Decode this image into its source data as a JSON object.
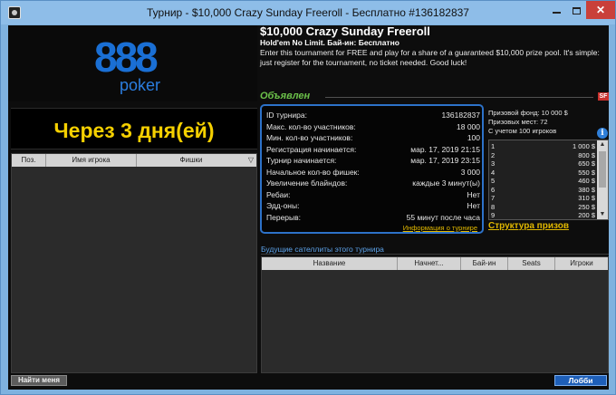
{
  "window": {
    "title": "Турнир - $10,000 Crazy Sunday Freeroll - Бесплатно #136182837",
    "controls": {
      "minimize_icon": "minimize-icon",
      "maximize_icon": "maximize-icon",
      "close_label": "✕"
    }
  },
  "logo": {
    "top": "888",
    "bottom": "poker"
  },
  "countdown": "Через 3 дня(ей)",
  "players_table": {
    "columns": [
      "Поз.",
      "Имя игрока",
      "Фишки"
    ],
    "sort_icon": "▽",
    "rows": []
  },
  "find_me_button": "Найти меня",
  "tournament": {
    "name": "$10,000 Crazy Sunday Freeroll",
    "game_line": "Hold'em No Limit. Бай-ин: Бесплатно",
    "description": "Enter this tournament for FREE and play for a share of a guaranteed $10,000 prize pool.  It's simple: just register for the tournament, no ticket needed.  Good luck!",
    "status": "Объявлен",
    "badge": "SF"
  },
  "info": [
    {
      "label": "ID турнира:",
      "value": "136182837"
    },
    {
      "label": "Макс. кол-во участников:",
      "value": "18 000"
    },
    {
      "label": "Мин. кол-во участников:",
      "value": "100"
    },
    {
      "label": "Регистрация начинается:",
      "value": "мар. 17, 2019 21:15"
    },
    {
      "label": "Турнир начинается:",
      "value": "мар. 17, 2019 23:15"
    },
    {
      "label": "Начальное кол-во фишек:",
      "value": "3 000"
    },
    {
      "label": "Увеличение блайндов:",
      "value": "каждые 3 минут(ы)"
    },
    {
      "label": "Ребаи:",
      "value": "Нет"
    },
    {
      "label": "Эдд-оны:",
      "value": "Нет"
    },
    {
      "label": "Перерыв:",
      "value": "55 минут после часа"
    }
  ],
  "info_link": "Информация о турнире",
  "prize": {
    "pool": "Призовой фонд: 10 000 $",
    "places": "Призовых мест: 72",
    "basis": "С учетом 100 игроков",
    "rows": [
      {
        "place": "1",
        "amount": "1 000 $"
      },
      {
        "place": "2",
        "amount": "800 $"
      },
      {
        "place": "3",
        "amount": "650 $"
      },
      {
        "place": "4",
        "amount": "550 $"
      },
      {
        "place": "5",
        "amount": "460 $"
      },
      {
        "place": "6",
        "amount": "380 $"
      },
      {
        "place": "7",
        "amount": "310 $"
      },
      {
        "place": "8",
        "amount": "250 $"
      },
      {
        "place": "9",
        "amount": "200 $"
      }
    ],
    "structure_link": "Структура призов"
  },
  "satellites": {
    "title": "Будущие сателлиты этого турнира",
    "columns": [
      "Название",
      "Начнет...",
      "Бай-ин",
      "Seats",
      "Игроки"
    ],
    "rows": []
  },
  "lobby_button": "Лобби",
  "colors": {
    "accent_yellow": "#f5d000",
    "link_gold": "#e1b800",
    "status_green": "#6cc24a",
    "brand_blue": "#1a6fd4",
    "info_border": "#2d72c9"
  }
}
